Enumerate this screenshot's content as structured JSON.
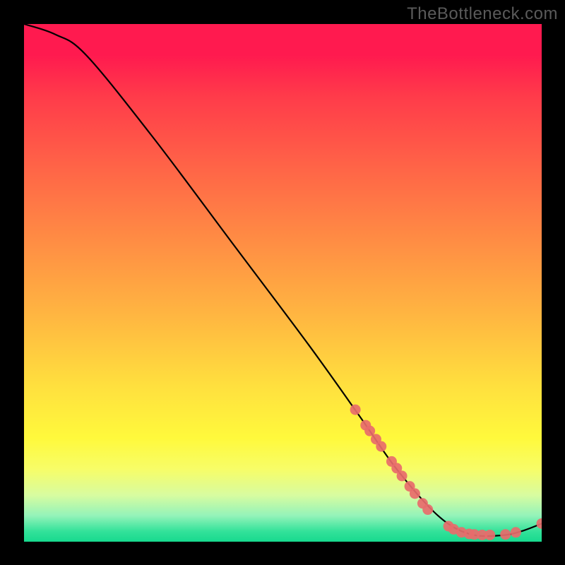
{
  "watermark": "TheBottleneck.com",
  "chart_data": {
    "type": "line",
    "title": "",
    "xlabel": "",
    "ylabel": "",
    "xlim": [
      0,
      100
    ],
    "ylim": [
      0,
      100
    ],
    "grid": false,
    "curve": [
      {
        "x": 0,
        "y": 100
      },
      {
        "x": 6,
        "y": 98
      },
      {
        "x": 12,
        "y": 94
      },
      {
        "x": 25,
        "y": 78
      },
      {
        "x": 40,
        "y": 58
      },
      {
        "x": 55,
        "y": 38
      },
      {
        "x": 65,
        "y": 24
      },
      {
        "x": 72,
        "y": 14
      },
      {
        "x": 80,
        "y": 5
      },
      {
        "x": 86,
        "y": 1.5
      },
      {
        "x": 92,
        "y": 1.2
      },
      {
        "x": 96,
        "y": 2.0
      },
      {
        "x": 100,
        "y": 3.5
      }
    ],
    "series": [
      {
        "name": "markers",
        "color": "#e86b6b",
        "points": [
          {
            "x": 64,
            "y": 25.5
          },
          {
            "x": 66,
            "y": 22.5
          },
          {
            "x": 66.8,
            "y": 21.4
          },
          {
            "x": 68,
            "y": 19.8
          },
          {
            "x": 69,
            "y": 18.4
          },
          {
            "x": 71,
            "y": 15.5
          },
          {
            "x": 72,
            "y": 14.2
          },
          {
            "x": 73,
            "y": 12.7
          },
          {
            "x": 74.5,
            "y": 10.7
          },
          {
            "x": 75.5,
            "y": 9.3
          },
          {
            "x": 77,
            "y": 7.4
          },
          {
            "x": 78,
            "y": 6.2
          },
          {
            "x": 82,
            "y": 3.0
          },
          {
            "x": 83,
            "y": 2.4
          },
          {
            "x": 84.5,
            "y": 1.8
          },
          {
            "x": 86,
            "y": 1.5
          },
          {
            "x": 87,
            "y": 1.4
          },
          {
            "x": 88.5,
            "y": 1.3
          },
          {
            "x": 90,
            "y": 1.3
          },
          {
            "x": 93,
            "y": 1.4
          },
          {
            "x": 95,
            "y": 1.8
          },
          {
            "x": 100,
            "y": 3.5
          }
        ]
      }
    ],
    "gradient_stops": [
      {
        "pos": 0.0,
        "color": "#ff1a4f"
      },
      {
        "pos": 0.06,
        "color": "#ff1a4f"
      },
      {
        "pos": 0.14,
        "color": "#ff3b4a"
      },
      {
        "pos": 0.28,
        "color": "#ff6547"
      },
      {
        "pos": 0.42,
        "color": "#ff8d44"
      },
      {
        "pos": 0.56,
        "color": "#ffb541"
      },
      {
        "pos": 0.7,
        "color": "#ffe03e"
      },
      {
        "pos": 0.8,
        "color": "#fff93c"
      },
      {
        "pos": 0.86,
        "color": "#f7fd68"
      },
      {
        "pos": 0.91,
        "color": "#d8fca0"
      },
      {
        "pos": 0.95,
        "color": "#93f3b9"
      },
      {
        "pos": 0.98,
        "color": "#33e29a"
      },
      {
        "pos": 1.0,
        "color": "#17d98e"
      }
    ]
  }
}
